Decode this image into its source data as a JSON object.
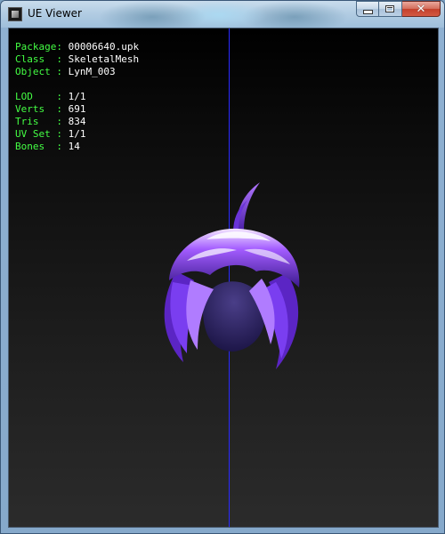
{
  "window": {
    "title": "UE Viewer",
    "buttons": {
      "minimize": "",
      "maximize": "",
      "close": "✕"
    }
  },
  "viewport": {
    "info": [
      {
        "label": "Package: ",
        "value": "00006640.upk"
      },
      {
        "label": "Class  : ",
        "value": "SkeletalMesh"
      },
      {
        "label": "Object : ",
        "value": "LynM_003"
      }
    ],
    "stats": [
      {
        "label": "LOD    : ",
        "value": "1/1"
      },
      {
        "label": "Verts  : ",
        "value": "691"
      },
      {
        "label": "Tris   : ",
        "value": "834"
      },
      {
        "label": "UV Set : ",
        "value": "1/1"
      },
      {
        "label": "Bones  : ",
        "value": "14"
      }
    ]
  },
  "colors": {
    "label": "#44ff44",
    "value": "#ffffff",
    "axis": "#2a2aff",
    "hair_primary": "#8b3dff",
    "hair_highlight": "#f0e0ff"
  }
}
